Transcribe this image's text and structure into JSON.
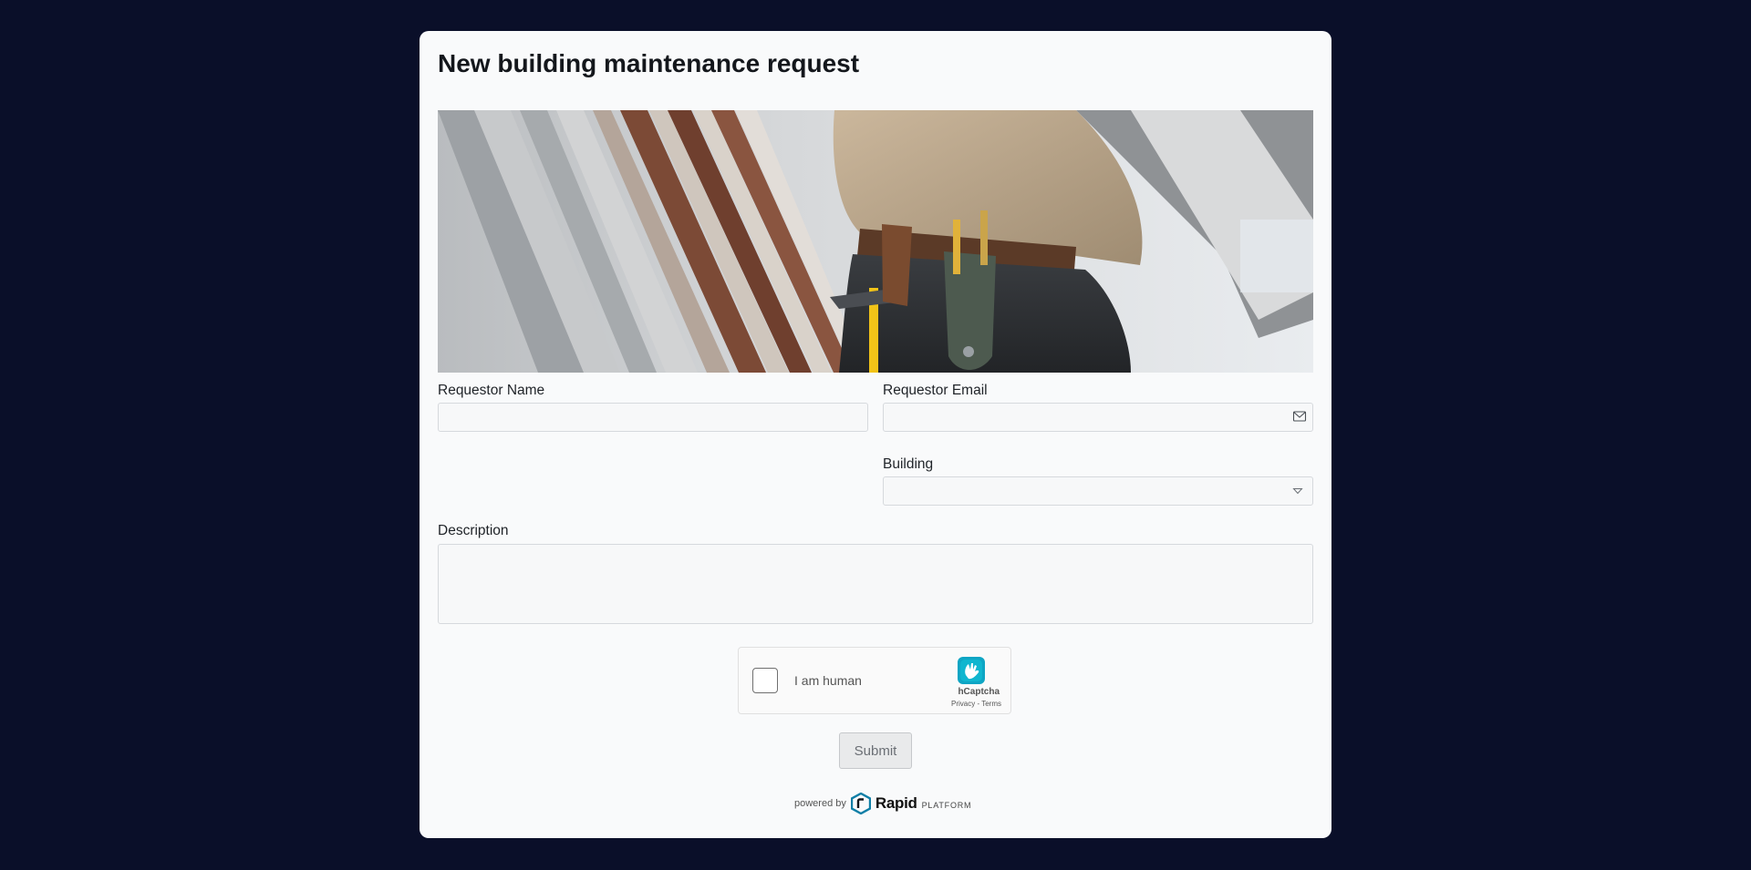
{
  "form": {
    "title": "New building maintenance request",
    "hero_image": "maintenance-worker-photo"
  },
  "fields": {
    "requestor_name": {
      "label": "Requestor Name",
      "value": "",
      "placeholder": ""
    },
    "requestor_email": {
      "label": "Requestor Email",
      "value": "",
      "placeholder": "",
      "icon": "envelope-icon"
    },
    "building": {
      "label": "Building",
      "value": "",
      "icon": "caret-down-icon"
    },
    "description": {
      "label": "Description",
      "value": ""
    }
  },
  "captcha": {
    "checkbox_label": "I am human",
    "brand": "hCaptcha",
    "privacy": "Privacy",
    "separator": " - ",
    "terms": "Terms",
    "checked": false
  },
  "submit": {
    "label": "Submit"
  },
  "footer": {
    "powered_by": "powered by",
    "brand": "Rapid",
    "platform": "PLATFORM"
  },
  "colors": {
    "page_background": "#0a0f29",
    "card_background": "#f9fafb",
    "brand_accent": "#0e7ea6"
  }
}
